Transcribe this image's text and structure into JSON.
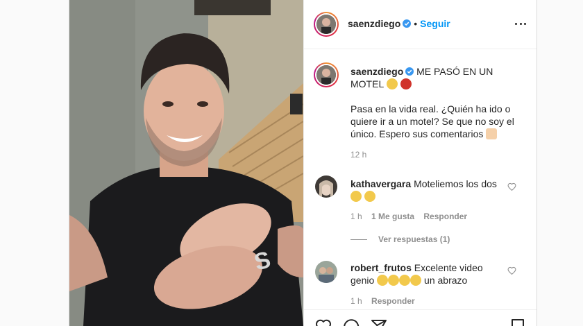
{
  "header": {
    "username": "saenzdiego",
    "separator": "•",
    "follow_label": "Seguir"
  },
  "caption": {
    "username": "saenzdiego",
    "title": "ME PASÓ EN UN MOTEL",
    "body": "Pasa en la vida real. ¿Quién ha ido o quiere ir a un motel? Se que no soy el único. Espero sus comentarios",
    "time": "12 h"
  },
  "comments": [
    {
      "username": "kathavergara",
      "text": "Moteliemos los dos",
      "time": "1 h",
      "likes": "1 Me gusta",
      "reply": "Responder",
      "view_replies": "Ver respuestas (1)"
    },
    {
      "username": "robert_frutos",
      "text": "Excelente video genio",
      "text_after_emoji": "un abrazo",
      "time": "1 h",
      "reply": "Responder"
    }
  ],
  "colors": {
    "accent": "#0095f6",
    "verified": "#3897f0",
    "text": "#262626",
    "muted": "#8e8e8e",
    "border": "#dbdbdb"
  },
  "icons": [
    "verified-badge-icon",
    "more-options-icon",
    "heart-icon",
    "comment-icon",
    "share-icon",
    "bookmark-icon"
  ]
}
